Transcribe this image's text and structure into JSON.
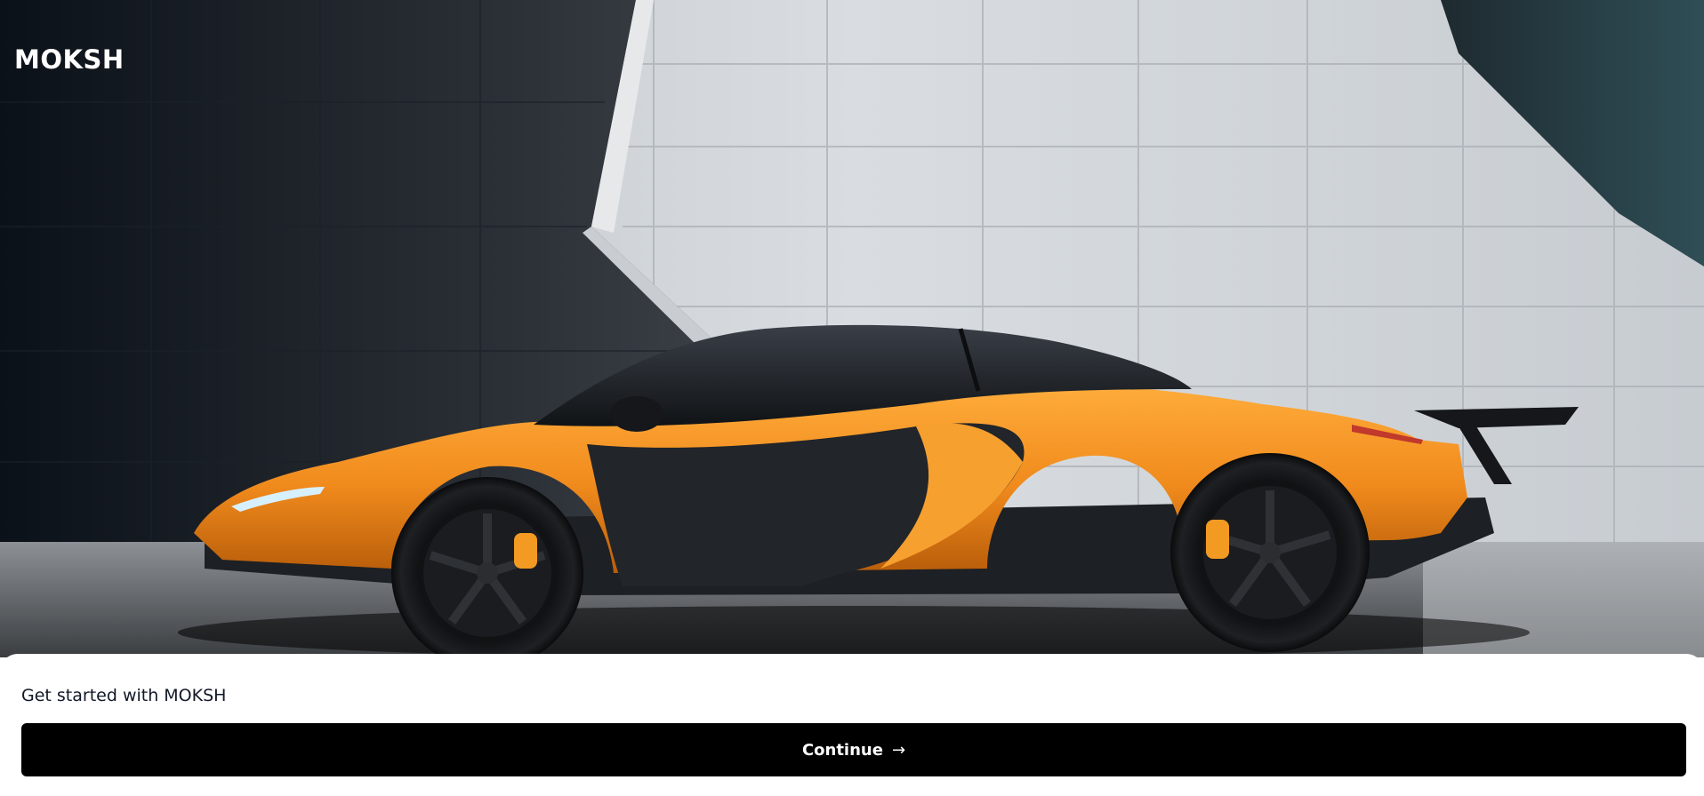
{
  "brand": {
    "name": "MOKSH"
  },
  "hero": {
    "image": "orange-supercar-photo"
  },
  "onboarding": {
    "title": "Get started with MOKSH",
    "continue_label": "Continue",
    "continue_icon": "arrow-right-icon",
    "arrow_glyph": "→"
  },
  "colors": {
    "car_body": "#f08a1c",
    "button_bg": "#000000",
    "button_text": "#ffffff"
  }
}
